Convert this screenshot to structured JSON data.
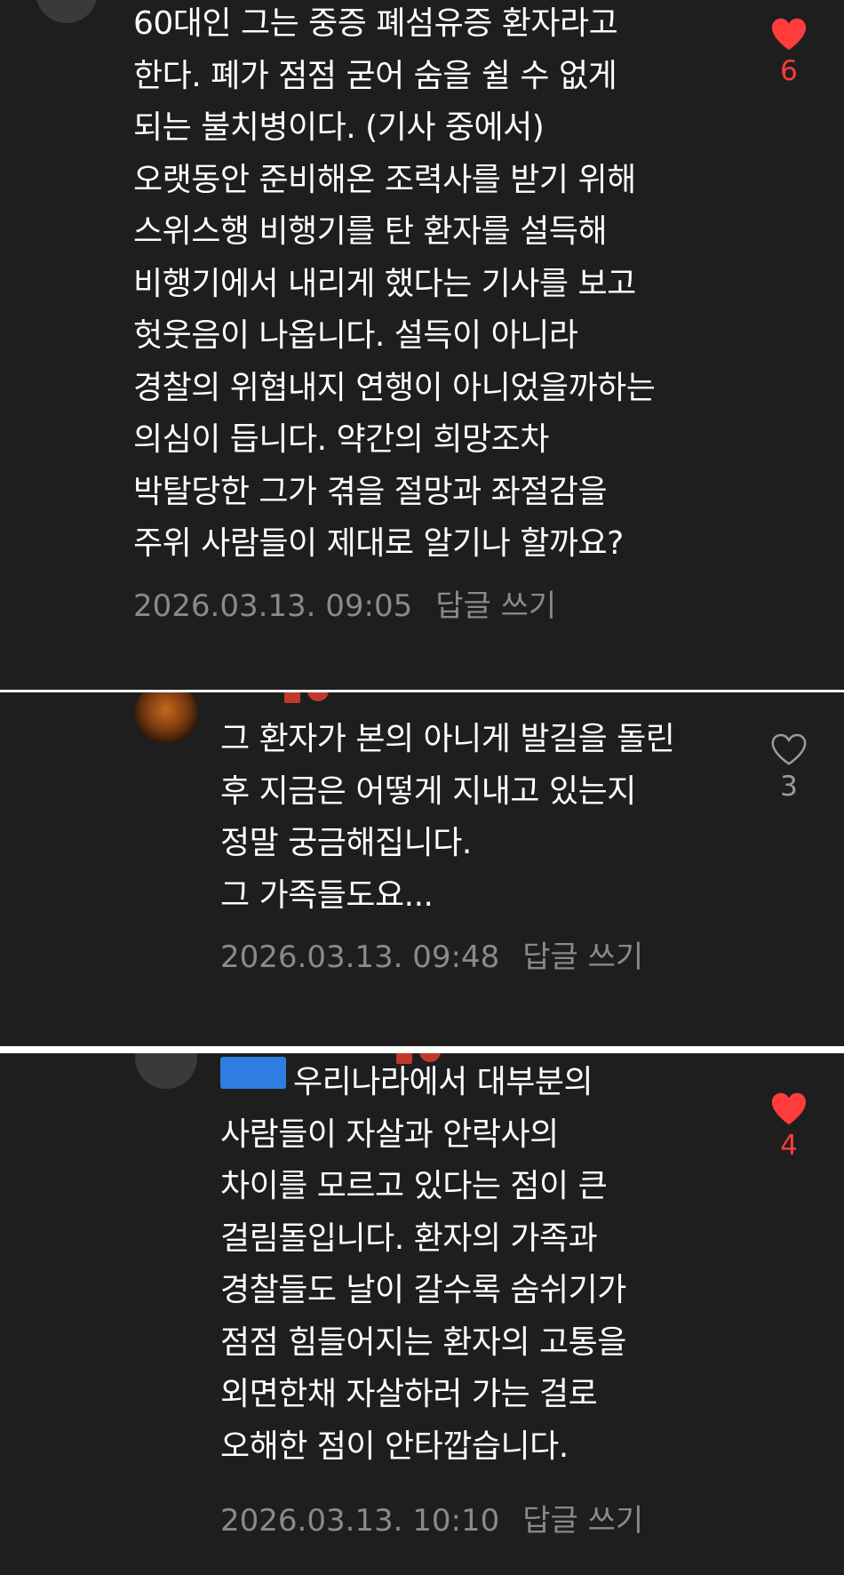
{
  "colors": {
    "background": "#1e1e1e",
    "divider": "#ffffff",
    "text": "#ffffff",
    "meta": "#8a8a8a",
    "like_active": "#ff3b3b",
    "like_inactive": "#9a9a9a",
    "mention": "#2f7de1"
  },
  "comments": [
    {
      "avatar": "default-avatar",
      "author": "",
      "lines": [
        "60대인 그는 중증 폐섬유증 환자라고",
        "한다. 폐가 점점 굳어 숨을 쉴 수 없게",
        "되는 불치병이다. (기사 중에서)",
        "오랫동안 준비해온 조력사를 받기 위해",
        "스위스행 비행기를 탄 환자를 설득해",
        "비행기에서 내리게 했다는 기사를 보고",
        "헛웃음이 나옵니다. 설득이 아니라",
        "경찰의 위협내지 연행이 아니었을까하는",
        "의심이 듭니다. 약간의 희망조차",
        "박탈당한 그가 겪을 절망과 좌절감을",
        "주위 사람들이 제대로 알기나 할까요?"
      ],
      "timestamp": "2026.03.13. 09:05",
      "reply_label": "답글 쓰기",
      "like": {
        "icon": "heart-filled-icon",
        "liked": true,
        "count": "6"
      }
    },
    {
      "avatar": "photo-avatar",
      "author": "",
      "lines": [
        "그 환자가 본의 아니게 발길을 돌린",
        "후 지금은 어떻게 지내고 있는지",
        "정말 궁금해집니다.",
        "그 가족들도요..."
      ],
      "timestamp": "2026.03.13. 09:48",
      "reply_label": "답글 쓰기",
      "like": {
        "icon": "heart-outline-icon",
        "liked": false,
        "count": "3"
      }
    },
    {
      "avatar": "default-avatar",
      "author": "",
      "mention": "",
      "lines": [
        "우리나라에서 대부분의",
        "사람들이 자살과 안락사의",
        "차이를 모르고 있다는 점이 큰",
        "걸림돌입니다. 환자의 가족과",
        "경찰들도 날이 갈수록 숨쉬기가",
        "점점 힘들어지는 환자의 고통을",
        "외면한채 자살하러 가는 걸로",
        "오해한 점이 안타깝습니다."
      ],
      "timestamp": "2026.03.13. 10:10",
      "reply_label": "답글 쓰기",
      "like": {
        "icon": "heart-filled-icon",
        "liked": true,
        "count": "4"
      }
    }
  ]
}
